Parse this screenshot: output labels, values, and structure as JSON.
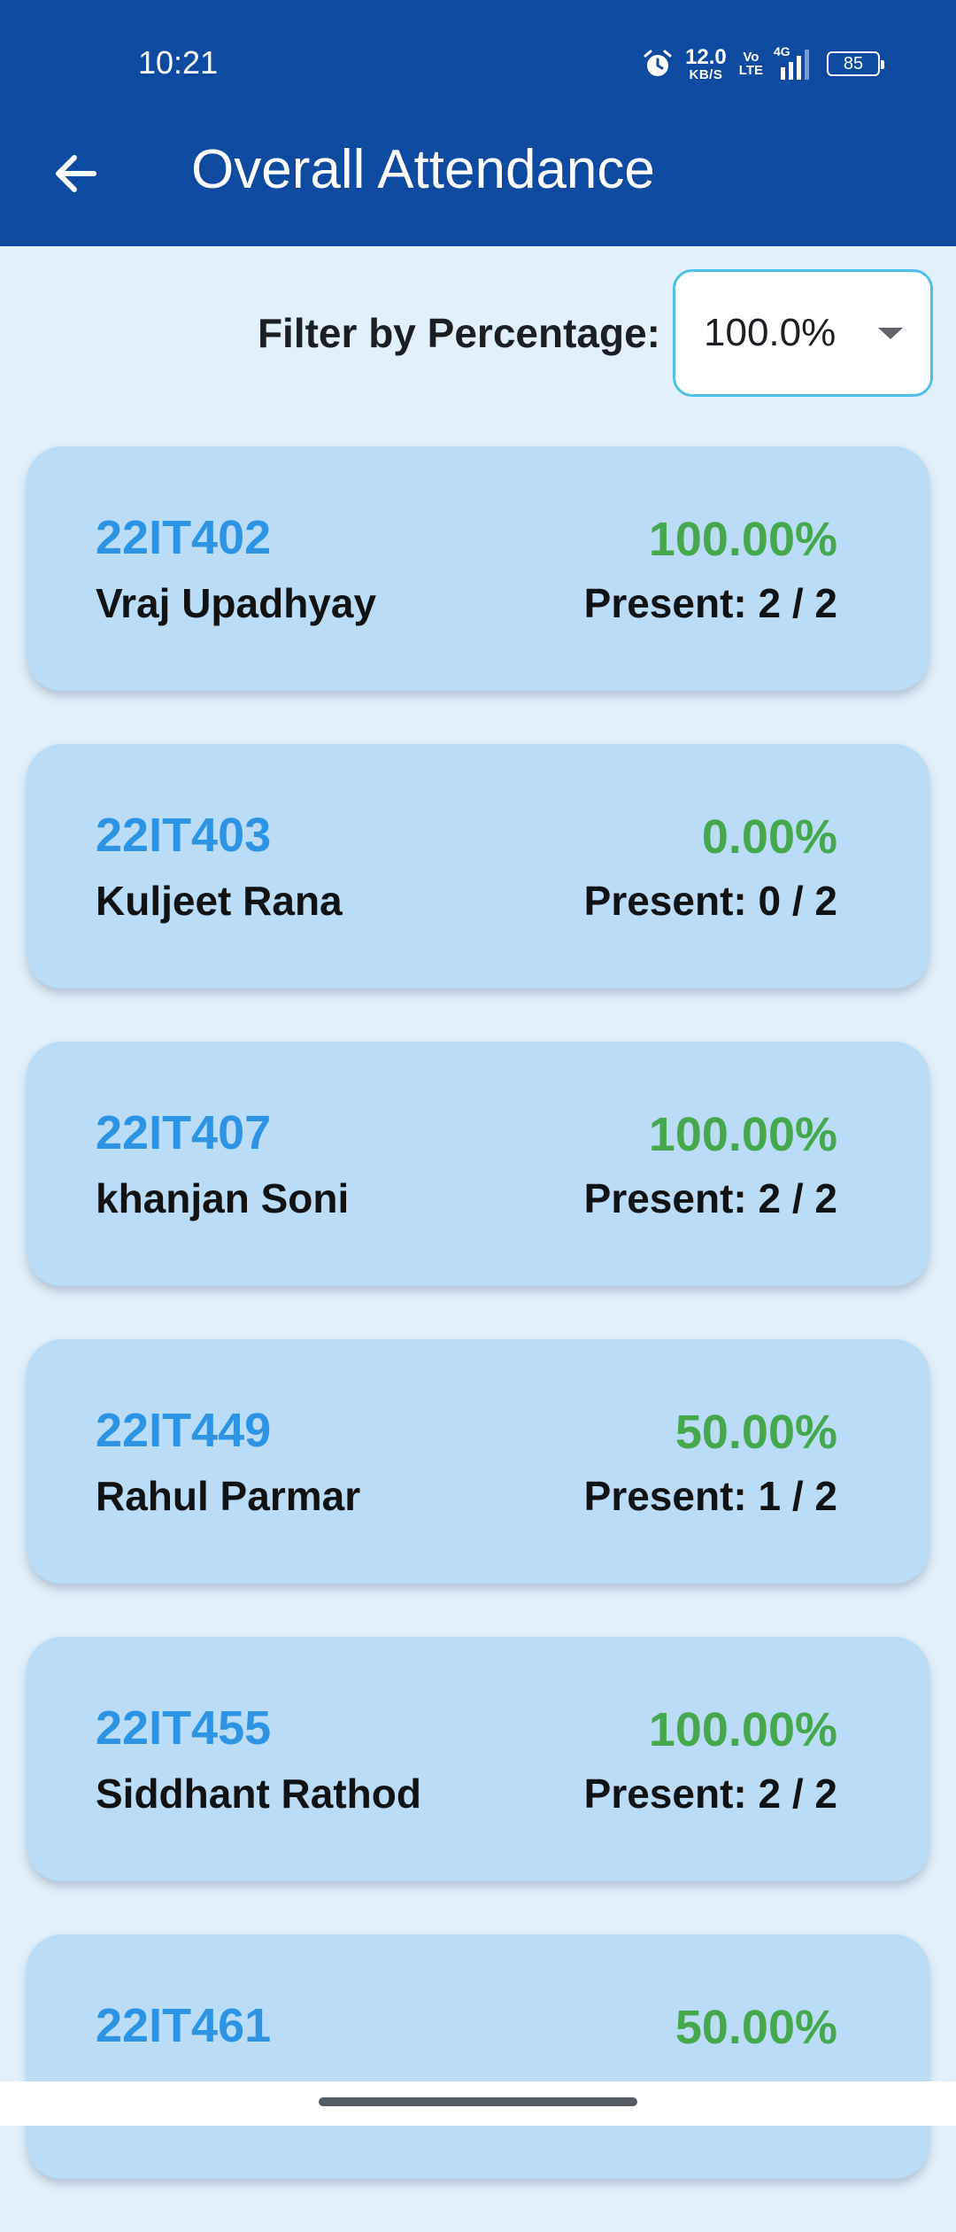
{
  "status_bar": {
    "time": "10:21",
    "net_speed_value": "12.0",
    "net_speed_unit": "KB/S",
    "volte_top": "Vo",
    "volte_bottom": "LTE",
    "network_type": "4G",
    "battery": "85",
    "icons": [
      "alarm-icon",
      "signal-icon",
      "battery-icon"
    ]
  },
  "header": {
    "title": "Overall Attendance",
    "back_icon": "arrow-left-icon",
    "color": "#0f4aa1"
  },
  "filter": {
    "label": "Filter by Percentage:",
    "selected": "100.0%",
    "dropdown_icon": "caret-down-icon"
  },
  "students": [
    {
      "id": "22IT402",
      "name": "Vraj Upadhyay",
      "percentage": "100.00%",
      "present": "Present: 2 / 2"
    },
    {
      "id": "22IT403",
      "name": "Kuljeet Rana",
      "percentage": "0.00%",
      "present": "Present: 0 / 2"
    },
    {
      "id": "22IT407",
      "name": "khanjan Soni",
      "percentage": "100.00%",
      "present": "Present: 2 / 2"
    },
    {
      "id": "22IT449",
      "name": "Rahul Parmar",
      "percentage": "50.00%",
      "present": "Present: 1 / 2"
    },
    {
      "id": "22IT455",
      "name": "Siddhant Rathod",
      "percentage": "100.00%",
      "present": "Present: 2 / 2"
    },
    {
      "id": "22IT461",
      "name": "",
      "percentage": "50.00%",
      "present": ""
    }
  ],
  "colors": {
    "background": "#e1f0fb",
    "card": "#bbdcf7",
    "id_text": "#2d93e4",
    "percentage_text": "#45a84c",
    "filter_border": "#4ec0ea"
  }
}
